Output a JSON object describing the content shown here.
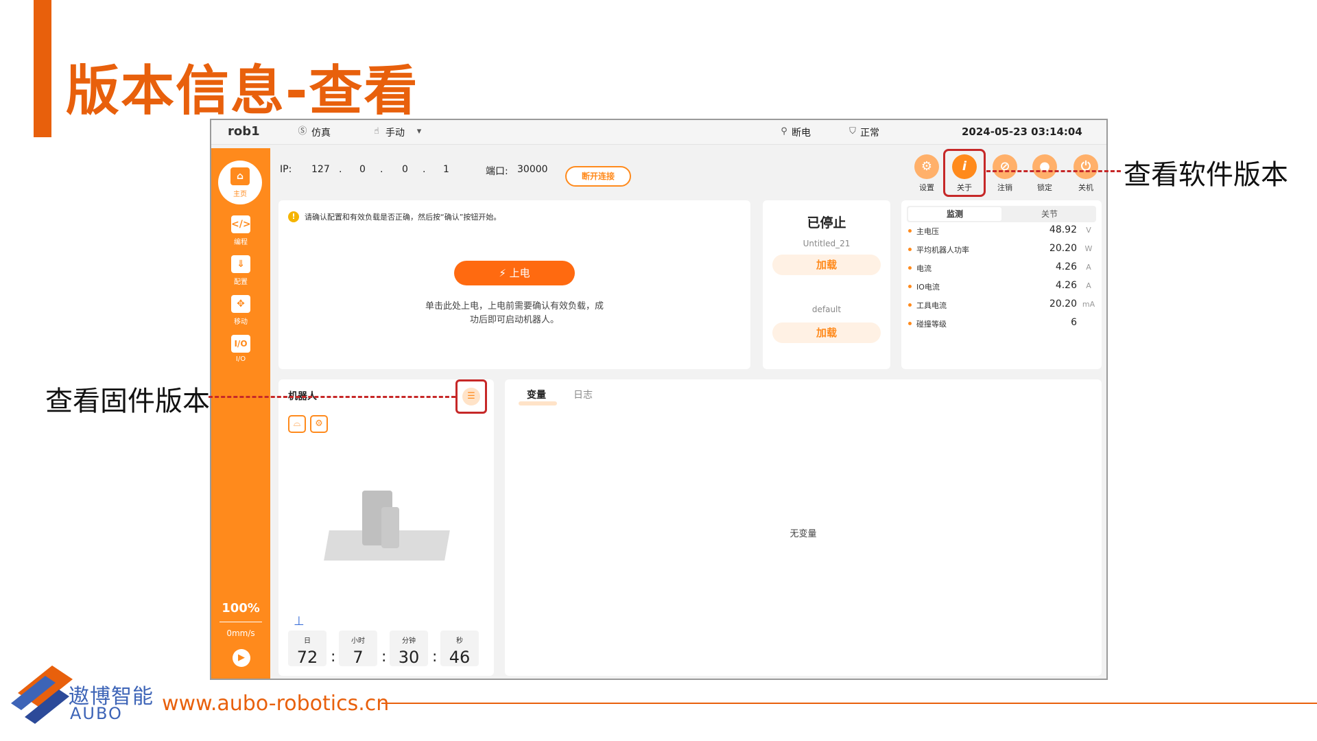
{
  "slide": {
    "title": "版本信息-查看",
    "footer_brand_cn": "遨博智能",
    "footer_brand_en": "AUBO",
    "footer_url": "www.aubo-robotics.cn"
  },
  "annotations": {
    "software": "查看软件版本",
    "firmware": "查看固件版本"
  },
  "topbar": {
    "robot_name": "rob1",
    "mode": "仿真",
    "control": "手动",
    "power": "断电",
    "safety": "正常",
    "datetime": "2024-05-23 03:14:04"
  },
  "sidebar": {
    "items": [
      {
        "label": "主页",
        "icon": "home-icon"
      },
      {
        "label": "编程",
        "icon": "code-icon"
      },
      {
        "label": "配置",
        "icon": "config-icon"
      },
      {
        "label": "移动",
        "icon": "move-icon"
      },
      {
        "label": "I/O",
        "icon": "io-icon"
      }
    ],
    "speed_percent": "100%",
    "speed_value": "0mm/s",
    "bottom_text": "????"
  },
  "connection": {
    "ip_label": "IP:",
    "ip": [
      "127",
      "0",
      "0",
      "1"
    ],
    "port_label": "端口:",
    "port": "30000",
    "disconnect": "断开连接"
  },
  "toolbar": [
    {
      "label": "设置",
      "icon": "settings-icon"
    },
    {
      "label": "关于",
      "icon": "info-icon"
    },
    {
      "label": "注销",
      "icon": "logout-icon"
    },
    {
      "label": "锁定",
      "icon": "lock-icon"
    },
    {
      "label": "关机",
      "icon": "power-icon"
    }
  ],
  "power_card": {
    "warning": "请确认配置和有效负载是否正确，然后按“确认”按钮开始。",
    "power_button": "上电",
    "description_line1": "单击此处上电，上电前需要确认有效负载，成",
    "description_line2": "功后即可启动机器人。"
  },
  "program_card": {
    "status": "已停止",
    "program_name": "Untitled_21",
    "load1": "加载",
    "payload": "default",
    "load2": "加载"
  },
  "monitor_card": {
    "tab_monitor": "监测",
    "tab_joint": "关节",
    "rows": [
      {
        "name": "主电压",
        "value": "48.92",
        "unit": "V"
      },
      {
        "name": "平均机器人功率",
        "value": "20.20",
        "unit": "W"
      },
      {
        "name": "电流",
        "value": "4.26",
        "unit": "A"
      },
      {
        "name": "IO电流",
        "value": "4.26",
        "unit": "A"
      },
      {
        "name": "工具电流",
        "value": "20.20",
        "unit": "mA"
      },
      {
        "name": "碰撞等级",
        "value": "6",
        "unit": ""
      }
    ]
  },
  "robot_card": {
    "title": "机器人",
    "runtime": [
      {
        "label": "日",
        "value": "72"
      },
      {
        "label": "小时",
        "value": "7"
      },
      {
        "label": "分钟",
        "value": "30"
      },
      {
        "label": "秒",
        "value": "46"
      }
    ],
    "separator": ":"
  },
  "variable_card": {
    "tab_variables": "变量",
    "tab_log": "日志",
    "empty": "无变量"
  },
  "colors": {
    "accent": "#FF8A1C",
    "title": "#E8600C",
    "highlight": "#C62828",
    "brand_blue": "#3d64b7"
  }
}
